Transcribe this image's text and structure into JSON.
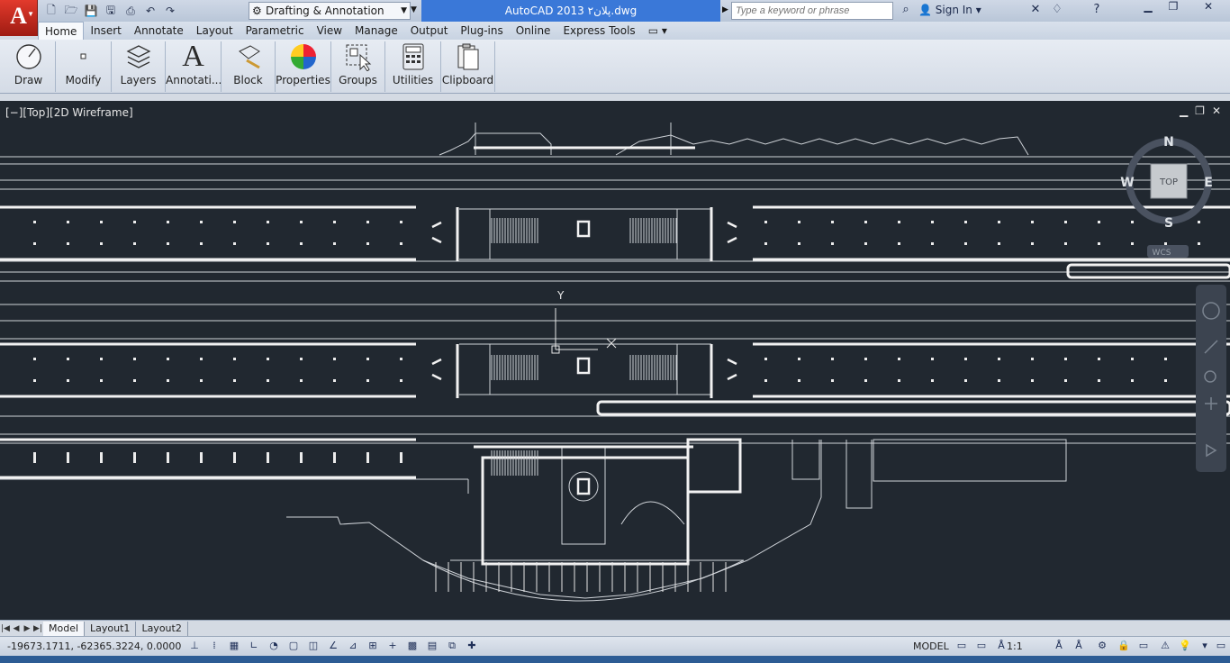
{
  "app": {
    "logo": "A",
    "title": "AutoCAD 2013  پلان۲.dwg"
  },
  "workspace": {
    "value": "Drafting & Annotation"
  },
  "search": {
    "placeholder": "Type a keyword or phrase"
  },
  "account": {
    "signin_label": "Sign In"
  },
  "ribbon_tabs": [
    "Home",
    "Insert",
    "Annotate",
    "Layout",
    "Parametric",
    "View",
    "Manage",
    "Output",
    "Plug-ins",
    "Online",
    "Express Tools"
  ],
  "ribbon_panels": [
    {
      "label": "Draw",
      "icon": "draw-icon"
    },
    {
      "label": "Modify",
      "icon": "modify-icon"
    },
    {
      "label": "Layers",
      "icon": "layers-icon"
    },
    {
      "label": "Annotati...",
      "icon": "annotation-icon"
    },
    {
      "label": "Block",
      "icon": "block-icon"
    },
    {
      "label": "Properties",
      "icon": "properties-icon"
    },
    {
      "label": "Groups",
      "icon": "groups-icon"
    },
    {
      "label": "Utilities",
      "icon": "utilities-icon"
    },
    {
      "label": "Clipboard",
      "icon": "clipboard-icon"
    }
  ],
  "viewport": {
    "label": "[−][Top][2D Wireframe]"
  },
  "viewcube": {
    "north": "N",
    "south": "S",
    "east": "E",
    "west": "W",
    "face": "TOP",
    "ucs": "WCS"
  },
  "ucs_icon": {
    "y_label": "Y"
  },
  "layout_tabs": [
    "Model",
    "Layout1",
    "Layout2"
  ],
  "status": {
    "coordinates": "-19673.1711, -62365.3224, 0.0000",
    "model_label": "MODEL",
    "scale": "1:1"
  },
  "colors": {
    "drawing_background": "#212830",
    "title_highlight": "#3a78d8",
    "app_button": "#c0281c"
  }
}
